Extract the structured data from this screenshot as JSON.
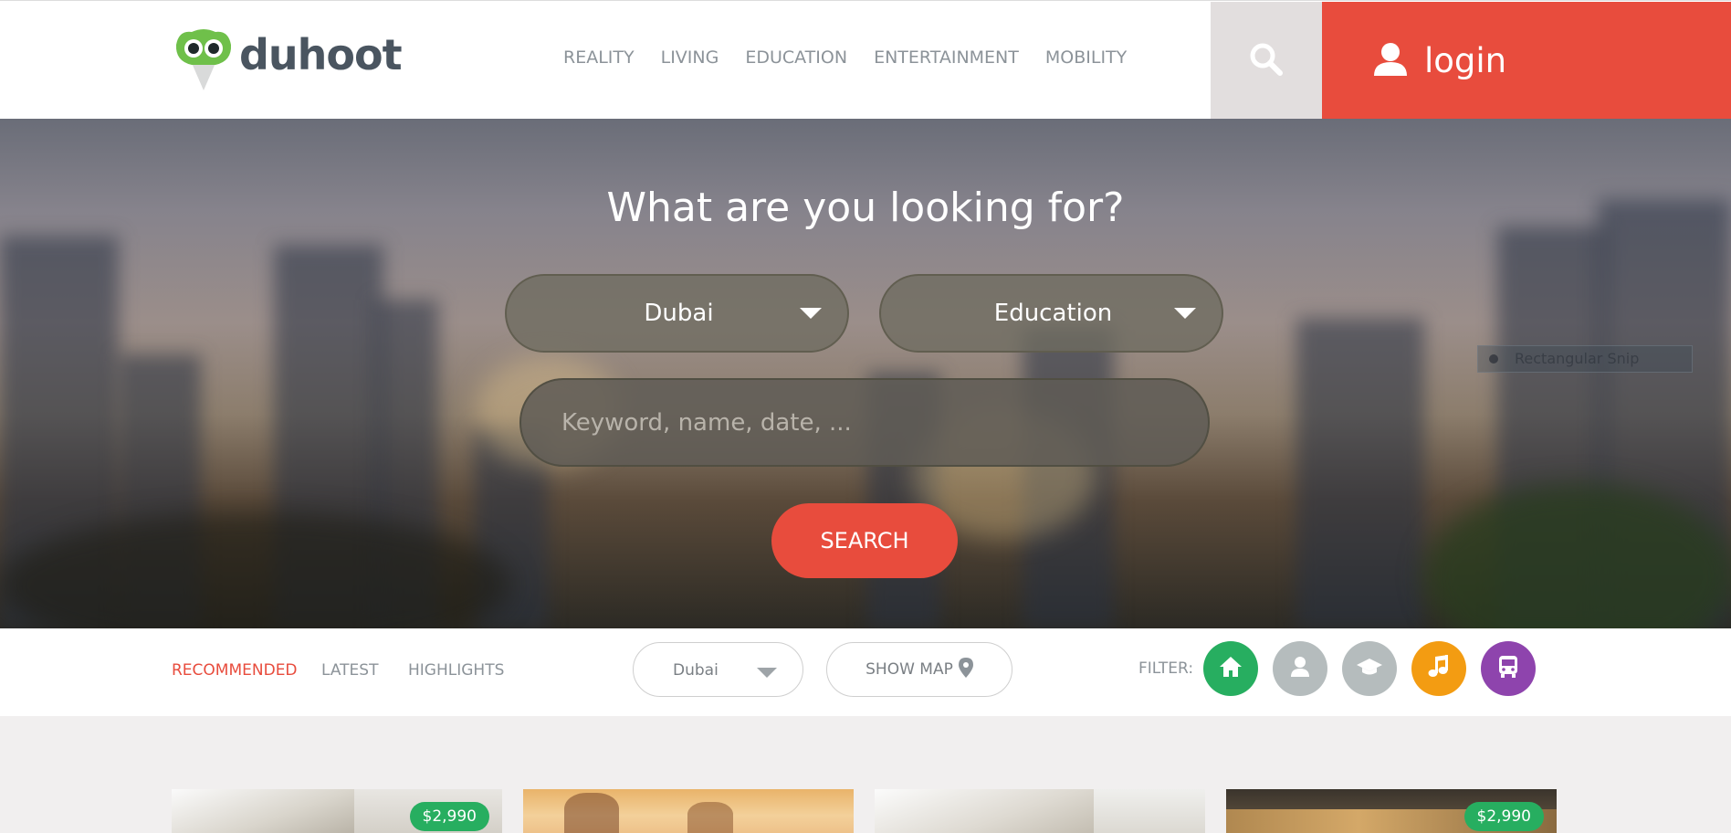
{
  "header": {
    "logo_text": "duhoot",
    "nav": [
      "REALITY",
      "LIVING",
      "EDUCATION",
      "ENTERTAINMENT",
      "MOBILITY"
    ],
    "login_label": "login",
    "search_icon": "search-icon",
    "user_icon": "user-icon"
  },
  "hero": {
    "title": "What are you looking for?",
    "city_select": "Dubai",
    "category_select": "Education",
    "keyword_placeholder": "Keyword, name, date, ...",
    "search_label": "SEARCH",
    "overlay_text": "Rectangular Snip"
  },
  "filter_bar": {
    "tabs": [
      "RECOMMENDED",
      "LATEST",
      "HIGHLIGHTS"
    ],
    "active_tab": "RECOMMENDED",
    "city": "Dubai",
    "map_label": "SHOW MAP",
    "filter_label": "FILTER:",
    "filters": [
      {
        "icon": "home-icon",
        "color": "#27ae60"
      },
      {
        "icon": "person-icon",
        "color": "#b5bcbd"
      },
      {
        "icon": "graduation-cap-icon",
        "color": "#b5bcbd"
      },
      {
        "icon": "music-icon",
        "color": "#f39c12"
      },
      {
        "icon": "bus-icon",
        "color": "#8e44ad"
      }
    ]
  },
  "cards": [
    {
      "price": "$2,990"
    },
    {
      "price": ""
    },
    {
      "price": ""
    },
    {
      "price": "$2,990"
    }
  ],
  "colors": {
    "accent": "#e84c3d",
    "green": "#27ae60",
    "orange": "#f39c12",
    "purple": "#8e44ad"
  }
}
